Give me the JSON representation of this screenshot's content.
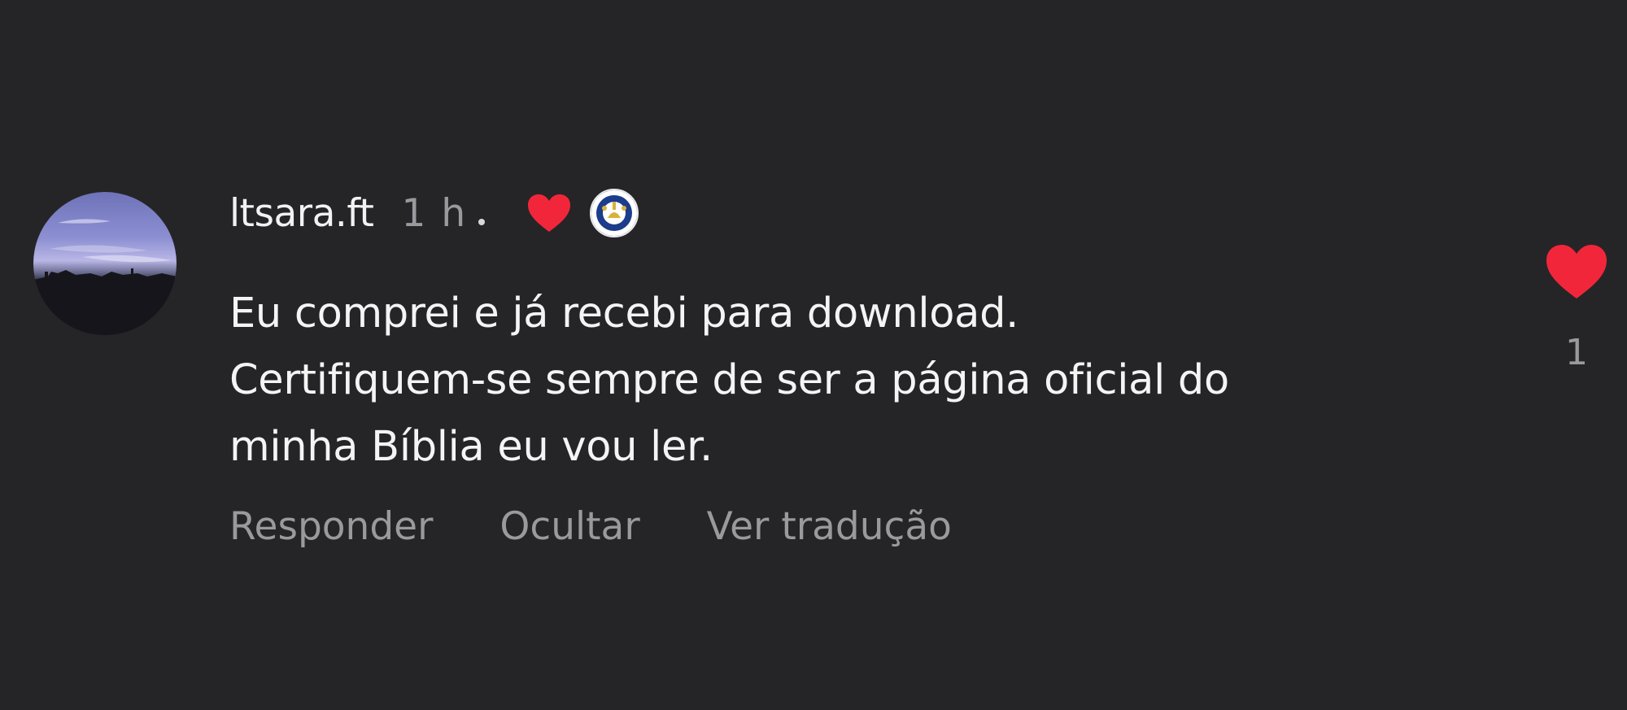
{
  "comment": {
    "username": "ltsara.ft",
    "time": "1 h",
    "text_lines": [
      "Eu comprei e já recebi para download.",
      "Certifiquem-se sempre de ser a página oficial do",
      "minha Bíblia eu vou ler."
    ],
    "actions": {
      "reply": "Responder",
      "hide": "Ocultar",
      "translate": "Ver tradução"
    },
    "like_count": "1",
    "liked_by_creator_icon": "heart-icon",
    "creator_badge_icon": "creator-avatar-icon",
    "like_icon": "heart-icon"
  },
  "colors": {
    "background": "#252527",
    "heart": "#f2263b",
    "primary_text": "#f2f2f2",
    "secondary_text": "#9a9a9e"
  }
}
